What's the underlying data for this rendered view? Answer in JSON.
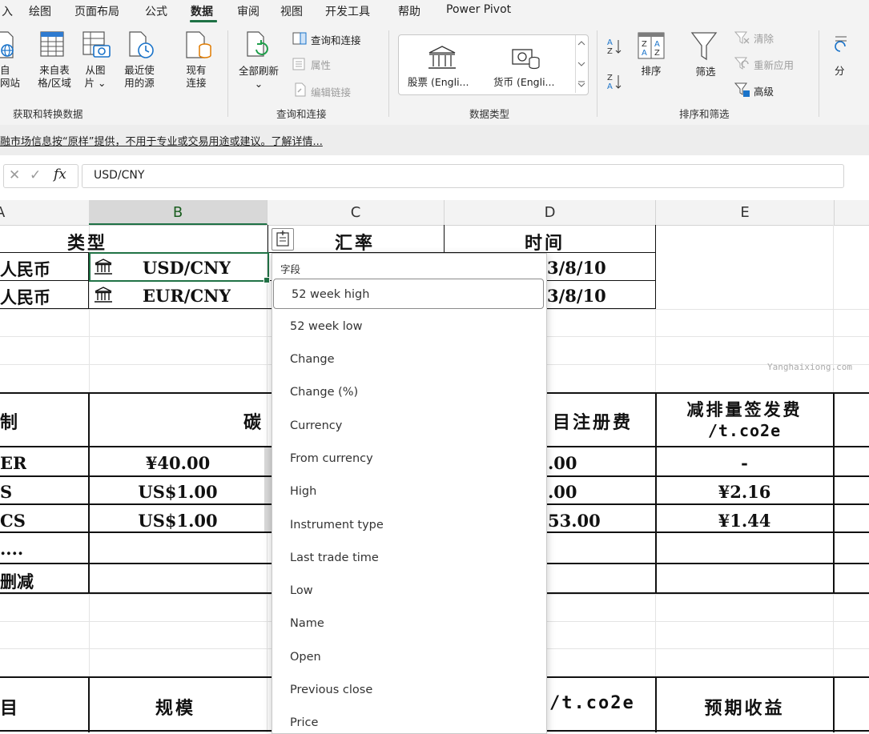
{
  "menu": {
    "items": [
      "入",
      "绘图",
      "页面布局",
      "公式",
      "数据",
      "审阅",
      "视图",
      "开发工具",
      "帮助",
      "Power Pivot"
    ],
    "active": "数据"
  },
  "ribbon": {
    "get_data": {
      "btn_web_1": "自",
      "btn_web_2": "网站",
      "btn_table_1": "来自表",
      "btn_table_2": "格/区域",
      "btn_picture_1": "从图",
      "btn_picture_2": "片 ⌄",
      "btn_recent_1": "最近使",
      "btn_recent_2": "用的源",
      "btn_existing_1": "现有",
      "btn_existing_2": "连接",
      "group_label": "获取和转换数据"
    },
    "queries": {
      "refresh_all_1": "全部刷新",
      "refresh_all_2": "⌄",
      "queries_connections": "查询和连接",
      "properties": "属性",
      "edit_links": "编辑链接",
      "group_label": "查询和连接"
    },
    "data_types": {
      "stocks": "股票 (Engli...",
      "currencies": "货币 (Engli...",
      "group_label": "数据类型"
    },
    "sort_filter": {
      "sort": "排序",
      "filter": "筛选",
      "clear": "清除",
      "reapply": "重新应用",
      "advanced": "高级",
      "group_label": "排序和筛选"
    },
    "extra_label": "分"
  },
  "infobar": {
    "text": "融市场信息按“原样”提供，不用于专业或交易用途或建议。了解详情..."
  },
  "formula_bar": {
    "cancel": "✕",
    "enter": "✓",
    "fx": "fx",
    "value": "USD/CNY"
  },
  "columns": [
    "A",
    "B",
    "C",
    "D",
    "E"
  ],
  "sheet": {
    "header_type": "类型",
    "header_rate": "汇率",
    "header_time": "时间",
    "row1_a": "人民币",
    "row1_b": "USD/CNY",
    "row1_d": "3/8/10",
    "row2_a": "人民币",
    "row2_b": "EUR/CNY",
    "row2_d": "3/8/10",
    "t2_hdr_a": "制",
    "t2_hdr_b": "碳",
    "t2_hdr_d": "目注册费",
    "t2_hdr_e1": "减排量签发费",
    "t2_hdr_e2": "/t.co2e",
    "t2_r1_a": "ER",
    "t2_r1_b": "¥40.00",
    "t2_r1_d": ".00",
    "t2_r1_e": "-",
    "t2_r2_a": "S",
    "t2_r2_b": "US$1.00",
    "t2_r2_d": ".00",
    "t2_r2_e": "¥2.16",
    "t2_r3_a": "CS",
    "t2_r3_b": "US$1.00",
    "t2_r3_d": "53.00",
    "t2_r3_e": "¥1.44",
    "t2_r4_a": "....",
    "t2_r5_a": "删减",
    "t3_hdr_a": "目",
    "t3_hdr_b": "规模",
    "t3_hdr_d": "/t.co2e",
    "t3_hdr_e": "预期收益"
  },
  "dropdown": {
    "title": "字段",
    "items": [
      "52 week high",
      "52 week low",
      "Change",
      "Change (%)",
      "Currency",
      "From currency",
      "High",
      "Instrument type",
      "Last trade time",
      "Low",
      "Name",
      "Open",
      "Previous close",
      "Price"
    ],
    "highlighted": "52 week high"
  },
  "watermark": "Yanghaixiong.com",
  "colors": {
    "accent": "#1e7145",
    "ribbon_bg": "#f3f3f3",
    "selection": "#217346"
  }
}
